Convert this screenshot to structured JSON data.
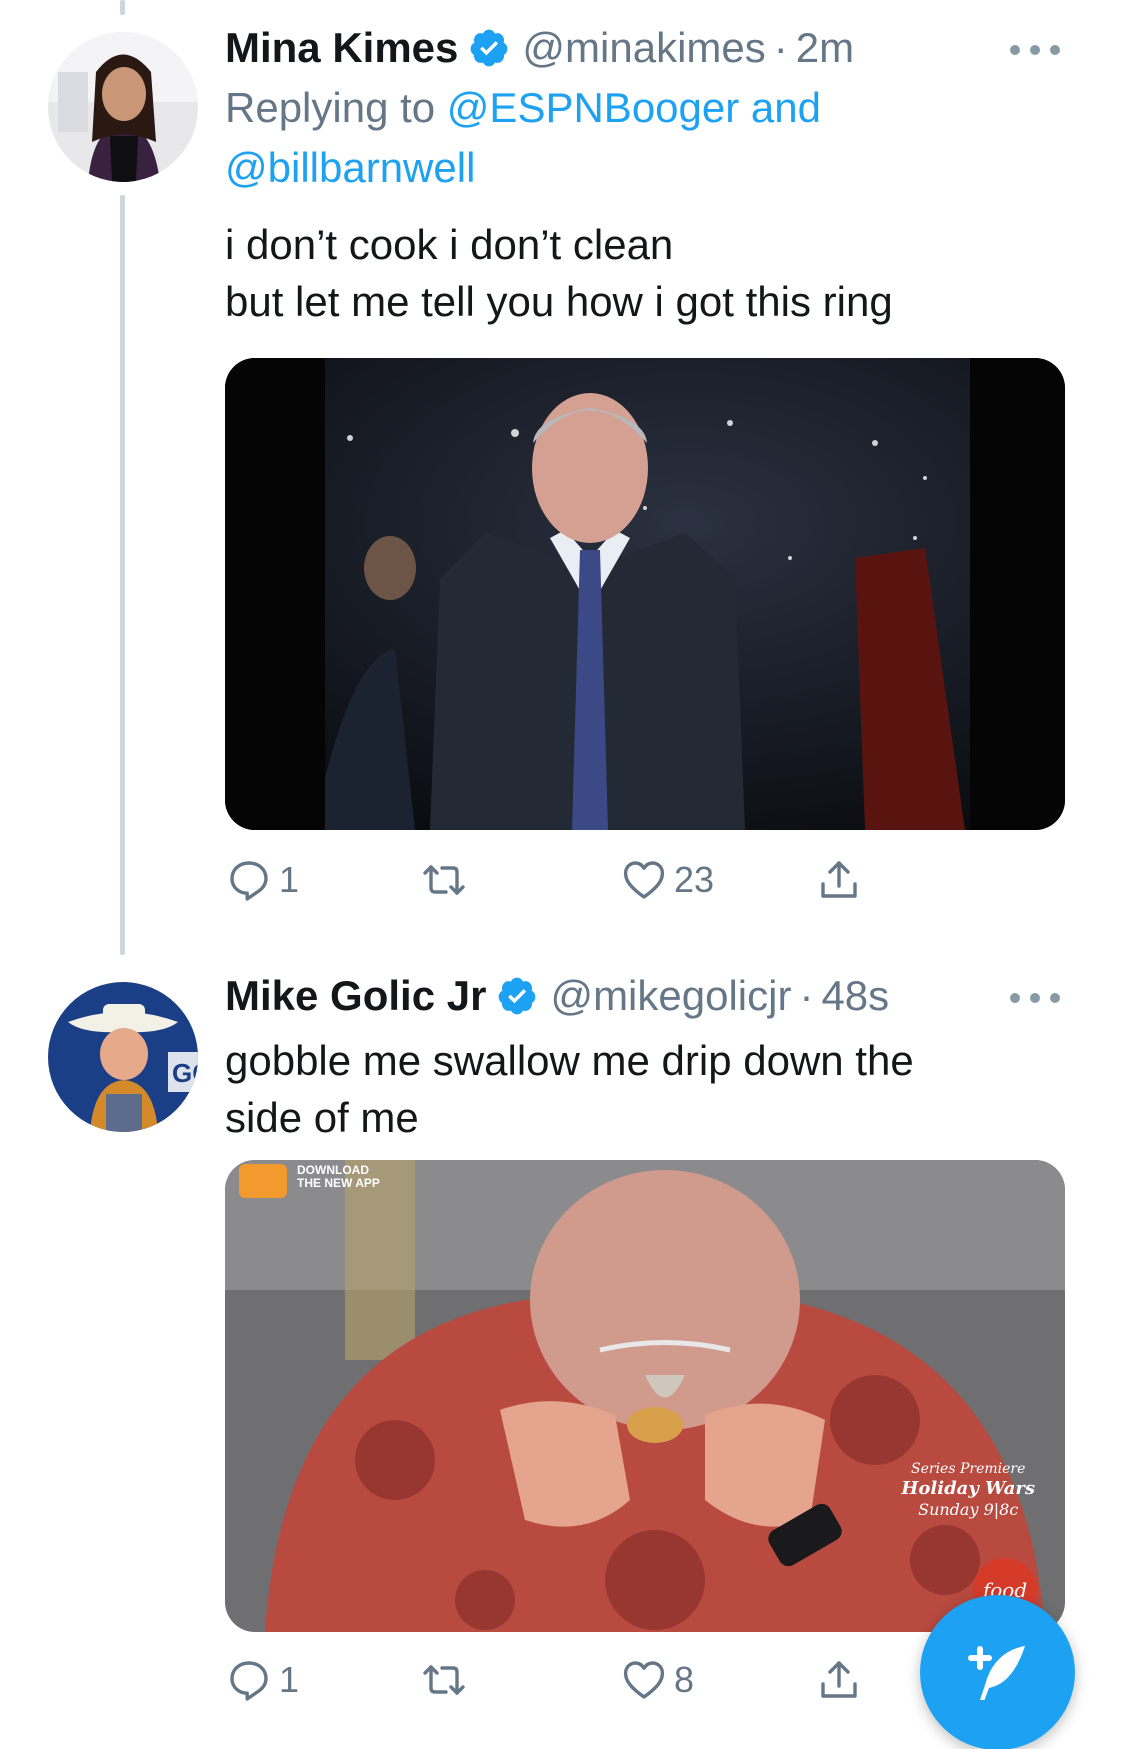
{
  "tweets": [
    {
      "name": "Mina Kimes",
      "handle": "@minakimes",
      "separator": "·",
      "time": "2m",
      "reply_prefix": "Replying to",
      "reply_user1": "@ESPNBooger",
      "reply_and": "and",
      "reply_user2": "@billbarnwell",
      "text_line1": "i don’t cook i don’t clean",
      "text_line2": "but let me tell you how i got this ring",
      "replies": "1",
      "retweets": "",
      "likes": "23"
    },
    {
      "name": "Mike Golic Jr",
      "handle": "@mikegolicjr",
      "separator": "·",
      "time": "48s",
      "text_line1": "gobble me swallow me drip down the",
      "text_line2": "side of me",
      "replies": "1",
      "retweets": "",
      "likes": "8",
      "avatar_text": "GC",
      "media_overlay": {
        "badge": "DOWNLOAD",
        "badge2": "THE NEW APP",
        "promo1": "Series Premiere",
        "promo2": "Holiday Wars",
        "promo3": "Sunday 9|8c",
        "logo": "food"
      }
    }
  ],
  "colors": {
    "accent": "#1da1f2",
    "muted": "#657786",
    "thread_line": "#ccd6dd"
  },
  "icons": [
    "verified-badge-icon",
    "more-icon",
    "reply-icon",
    "retweet-icon",
    "like-icon",
    "share-icon",
    "compose-tweet-icon"
  ]
}
